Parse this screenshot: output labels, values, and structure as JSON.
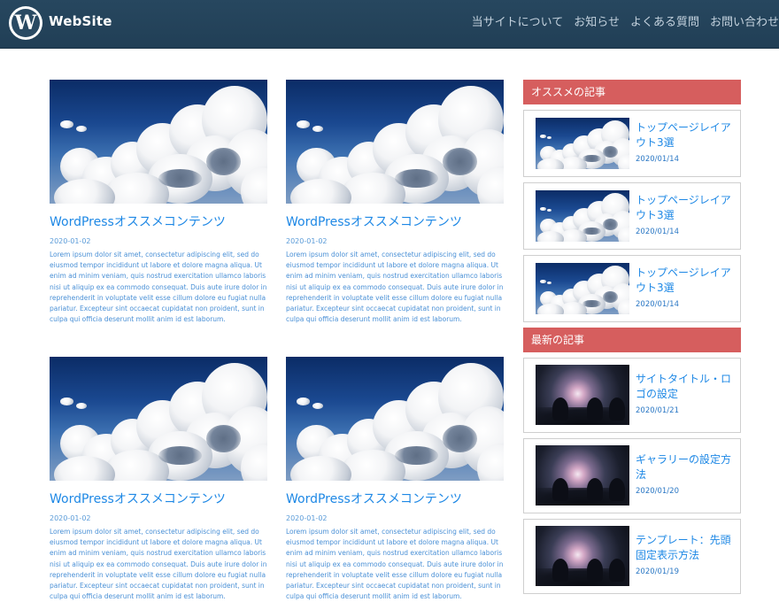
{
  "site": {
    "name": "WebSite"
  },
  "nav": [
    "当サイトについて",
    "お知らせ",
    "よくある質問",
    "お問い合わせ"
  ],
  "posts": [
    {
      "title": "WordPressオススメコンテンツ",
      "date": "2020-01-02",
      "excerpt": "Lorem ipsum dolor sit amet, consectetur adipiscing elit, sed do eiusmod tempor incididunt ut labore et dolore magna aliqua. Ut enim ad minim veniam, quis nostrud exercitation ullamco laboris nisi ut aliquip ex ea commodo consequat. Duis aute irure dolor in reprehenderit in voluptate velit esse cillum dolore eu fugiat nulla pariatur. Excepteur sint occaecat cupidatat non proident, sunt in culpa qui officia deserunt mollit anim id est laborum."
    },
    {
      "title": "WordPressオススメコンテンツ",
      "date": "2020-01-02",
      "excerpt": "Lorem ipsum dolor sit amet, consectetur adipiscing elit, sed do eiusmod tempor incididunt ut labore et dolore magna aliqua. Ut enim ad minim veniam, quis nostrud exercitation ullamco laboris nisi ut aliquip ex ea commodo consequat. Duis aute irure dolor in reprehenderit in voluptate velit esse cillum dolore eu fugiat nulla pariatur. Excepteur sint occaecat cupidatat non proident, sunt in culpa qui officia deserunt mollit anim id est laborum."
    },
    {
      "title": "WordPressオススメコンテンツ",
      "date": "2020-01-02",
      "excerpt": "Lorem ipsum dolor sit amet, consectetur adipiscing elit, sed do eiusmod tempor incididunt ut labore et dolore magna aliqua. Ut enim ad minim veniam, quis nostrud exercitation ullamco laboris nisi ut aliquip ex ea commodo consequat. Duis aute irure dolor in reprehenderit in voluptate velit esse cillum dolore eu fugiat nulla pariatur. Excepteur sint occaecat cupidatat non proident, sunt in culpa qui officia deserunt mollit anim id est laborum."
    },
    {
      "title": "WordPressオススメコンテンツ",
      "date": "2020-01-02",
      "excerpt": "Lorem ipsum dolor sit amet, consectetur adipiscing elit, sed do eiusmod tempor incididunt ut labore et dolore magna aliqua. Ut enim ad minim veniam, quis nostrud exercitation ullamco laboris nisi ut aliquip ex ea commodo consequat. Duis aute irure dolor in reprehenderit in voluptate velit esse cillum dolore eu fugiat nulla pariatur. Excepteur sint occaecat cupidatat non proident, sunt in culpa qui officia deserunt mollit anim id est laborum."
    }
  ],
  "sidebar": {
    "recommended": {
      "heading": "オススメの記事",
      "items": [
        {
          "title": "トップページレイアウト3選",
          "date": "2020/01/14"
        },
        {
          "title": "トップページレイアウト3選",
          "date": "2020/01/14"
        },
        {
          "title": "トップページレイアウト3選",
          "date": "2020/01/14"
        }
      ]
    },
    "latest": {
      "heading": "最新の記事",
      "items": [
        {
          "title": "サイトタイトル・ロゴの設定",
          "date": "2020/01/21"
        },
        {
          "title": "ギャラリーの設定方法",
          "date": "2020/01/20"
        },
        {
          "title": "テンプレート：先頭固定表示方法",
          "date": "2020/01/19"
        }
      ]
    }
  }
}
